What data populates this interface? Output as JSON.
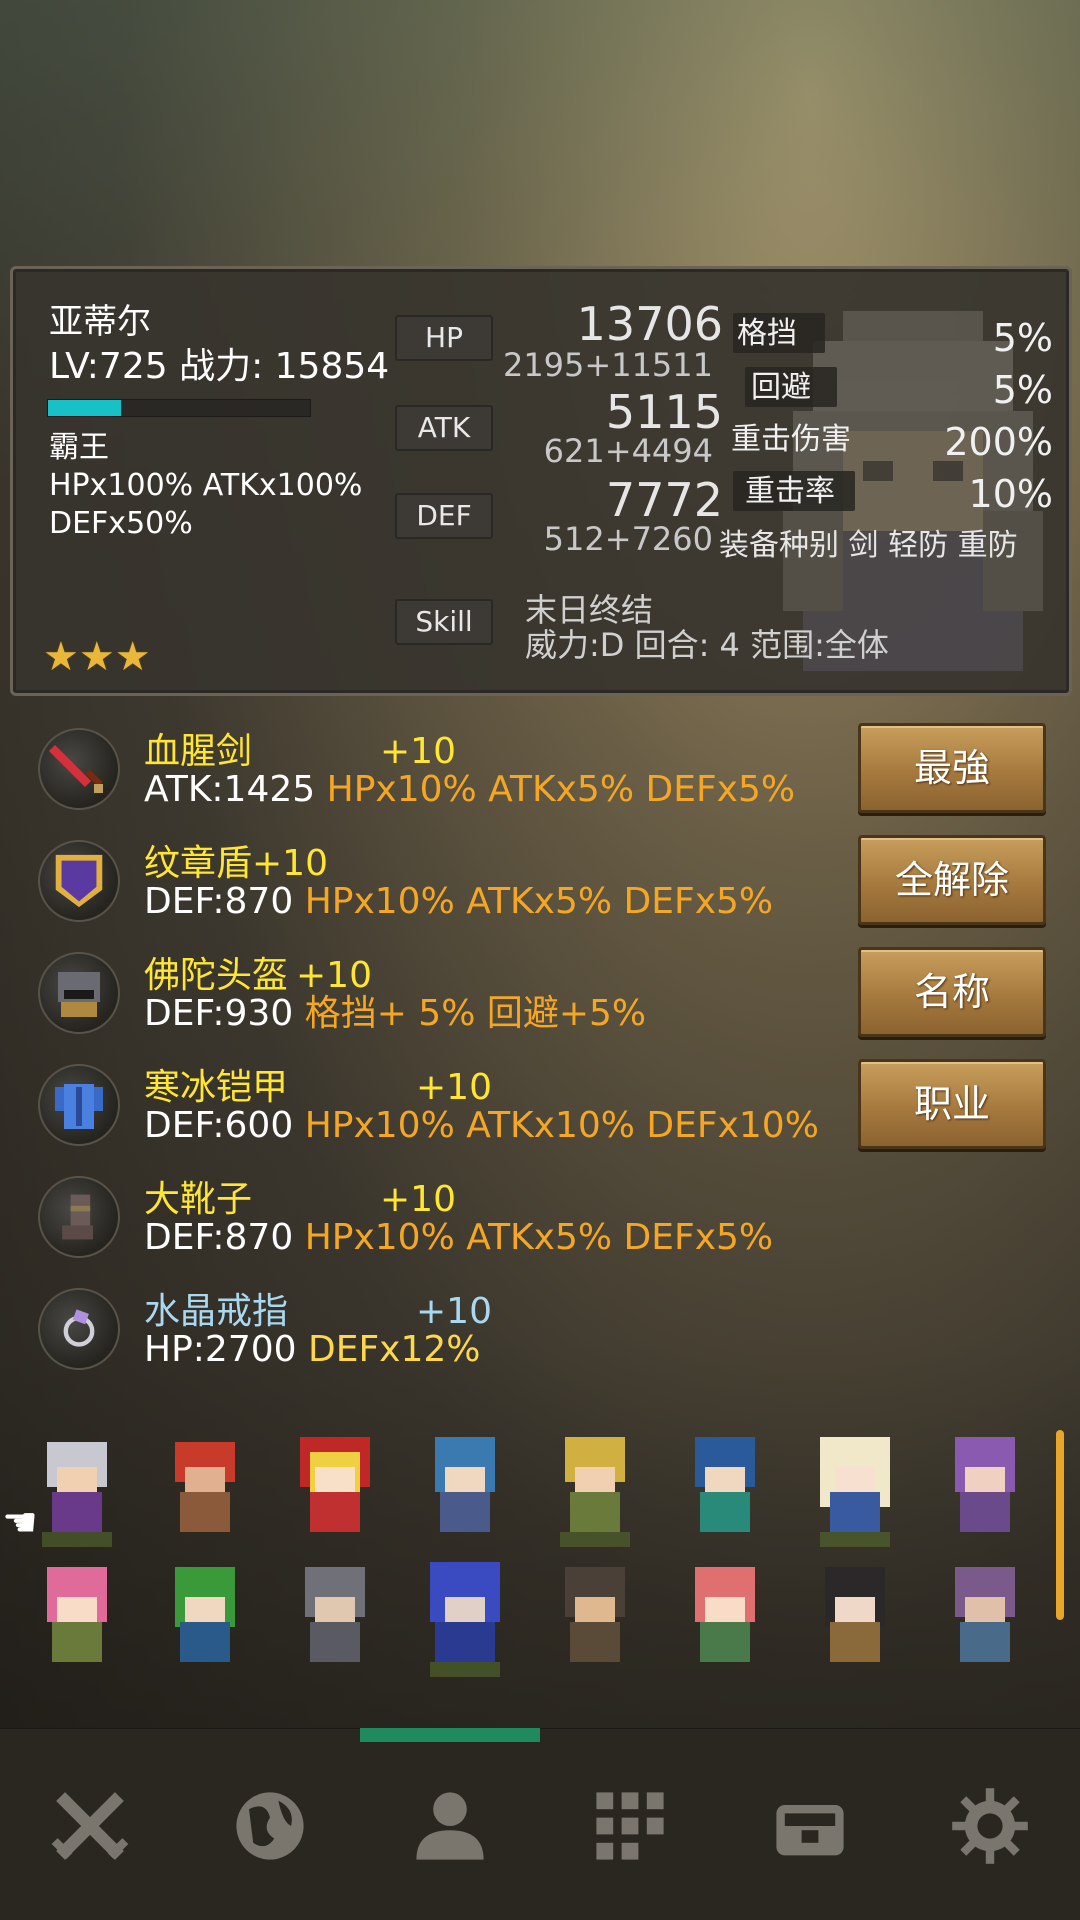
{
  "character": {
    "name": "亚蒂尔",
    "level_line": "LV:725 战力: 15854",
    "xp_progress": 0.28,
    "class_name": "霸王",
    "multipliers_line1": "HPx100% ATKx100%",
    "multipliers_line2": "DEFx50%",
    "stars": "★★★"
  },
  "stats": {
    "hp_label": "HP",
    "hp_total": "13706",
    "hp_breakdown": "2195+11511",
    "atk_label": "ATK",
    "atk_total": "5115",
    "atk_breakdown": "621+4494",
    "def_label": "DEF",
    "def_total": "7772",
    "def_breakdown": "512+7260",
    "skill_label": "Skill",
    "skill_name": "末日终结",
    "skill_desc": "威力:D 回合:  4 范围:全体"
  },
  "secondary": {
    "block_label": "格挡",
    "block_value": "5%",
    "evade_label": "回避",
    "evade_value": "5%",
    "crit_dmg_label": "重击伤害",
    "crit_dmg_value": "200%",
    "crit_rate_label": "重击率",
    "crit_rate_value": "10%",
    "equip_types_line": "装备种别 剑 轻防 重防"
  },
  "equipment": [
    {
      "name": "血腥剑",
      "level": "+10",
      "base": "ATK:1425",
      "bonus": "HPx10% ATKx5% DEFx5%",
      "icon": "sword-icon",
      "name_color": "#ffe633"
    },
    {
      "name": "纹章盾",
      "level": "+10",
      "base": "DEF:870",
      "bonus": "HPx10% ATKx5% DEFx5%",
      "icon": "shield-icon",
      "name_color": "#ffe633"
    },
    {
      "name": "佛陀头盔",
      "level": "+10",
      "base": "DEF:930",
      "bonus": "格挡+   5% 回避+5%",
      "icon": "helmet-icon",
      "name_color": "#ffe633"
    },
    {
      "name": "寒冰铠甲",
      "level": "+10",
      "base": "DEF:600",
      "bonus": "HPx10% ATKx10% DEFx10%",
      "icon": "armor-icon",
      "name_color": "#ffe633"
    },
    {
      "name": "大靴子",
      "level": "+10",
      "base": "DEF:870",
      "bonus": "HPx10% ATKx5% DEFx5%",
      "icon": "boots-icon",
      "name_color": "#ffe633"
    },
    {
      "name": "水晶戒指",
      "level": "+10",
      "base": "HP:2700",
      "bonus": "DEFx12%",
      "icon": "ring-icon",
      "name_color": "#a9d8f0"
    }
  ],
  "buttons": {
    "strongest": "最強",
    "unequip_all": "全解除",
    "name_sort": "名称",
    "class_sort": "职业"
  },
  "nav": {
    "icons": [
      "battle-icon",
      "world-icon",
      "character-icon",
      "grid-menu-icon",
      "chest-icon",
      "settings-icon"
    ],
    "active_index": 2,
    "active_color": "#1e8a5e"
  },
  "colors": {
    "accent_gold": "#f5a623",
    "name_yellow": "#ffe633",
    "xp_bar": "#18c0c8",
    "button_wood": "#a67a3e"
  }
}
